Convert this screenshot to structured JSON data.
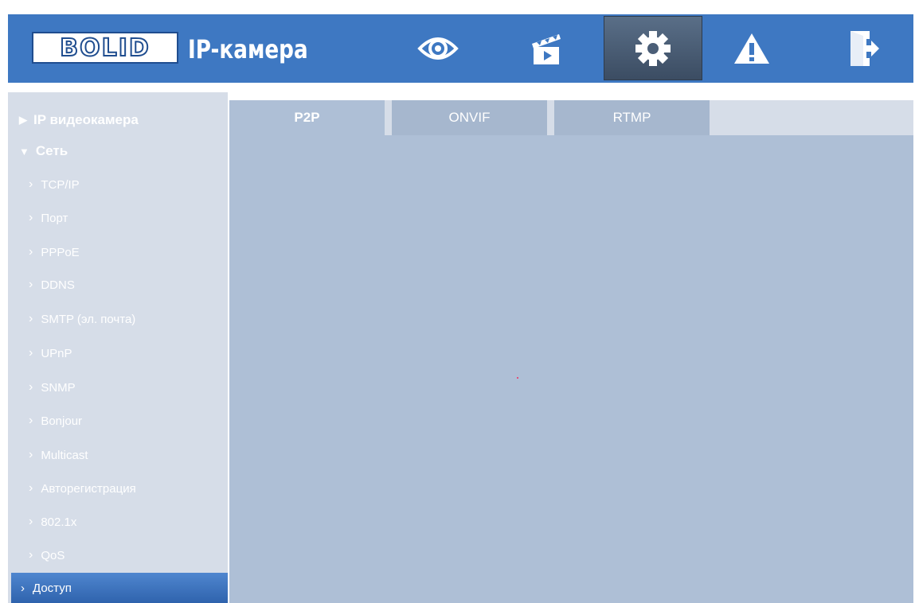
{
  "header": {
    "logo": "BOLID",
    "title": "IP-камера",
    "nav": [
      {
        "icon": "eye-icon",
        "active": false
      },
      {
        "icon": "clapperboard-icon",
        "active": false
      },
      {
        "icon": "gear-icon",
        "active": true
      },
      {
        "icon": "warning-icon",
        "active": false
      },
      {
        "icon": "logout-icon",
        "active": false
      }
    ]
  },
  "sidebar": {
    "sections": [
      {
        "label": "IP видеокамера",
        "expanded": false
      },
      {
        "label": "Сеть",
        "expanded": true
      }
    ],
    "items": [
      "TCP/IP",
      "Порт",
      "PPPoE",
      "DDNS",
      "SMTP (эл. почта)",
      "UPnP",
      "SNMP",
      "Bonjour",
      "Multicast",
      "Авторегистрация",
      "802.1x",
      "QoS",
      "Доступ"
    ],
    "active_item": "Доступ"
  },
  "tabs": [
    {
      "label": "P2P",
      "active": true
    },
    {
      "label": "ONVIF",
      "active": false
    },
    {
      "label": "RTMP",
      "active": false
    }
  ],
  "colors": {
    "header": "#3e78c2",
    "sidebar": "#d6dde8",
    "main": "#aebfd6",
    "active_item": "#3a71bd"
  }
}
